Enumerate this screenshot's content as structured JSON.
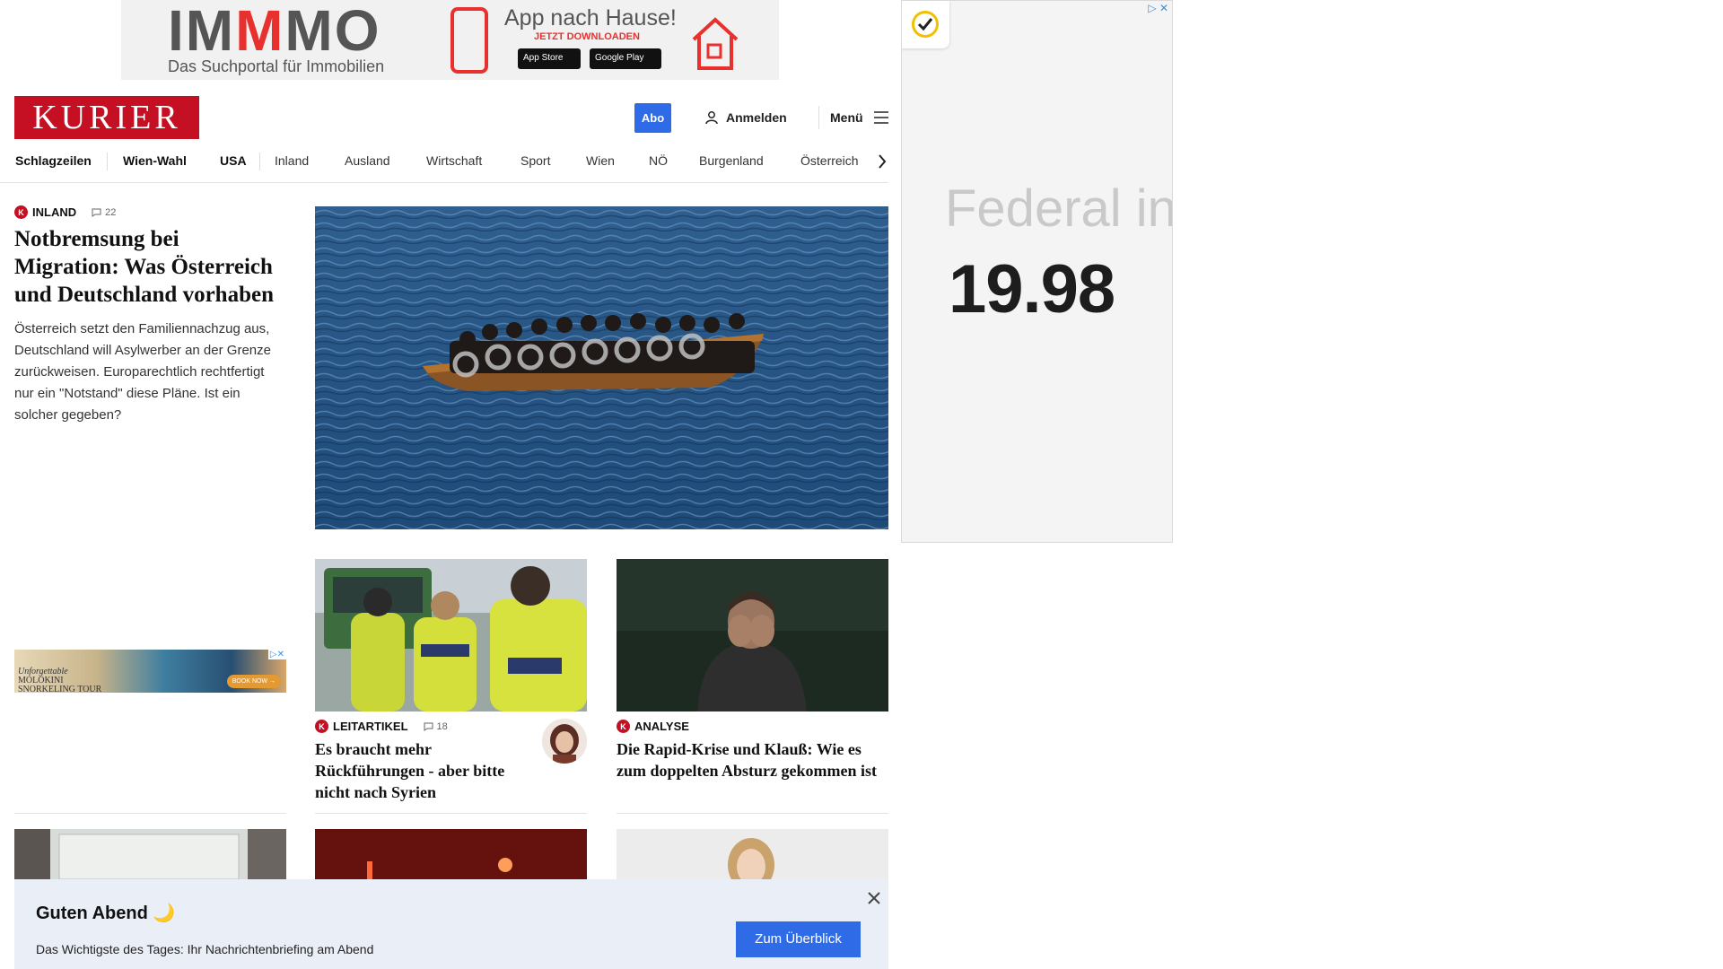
{
  "top_ad": {
    "logo_letters": [
      "IM",
      "M",
      "MO"
    ],
    "subtitle": "Das Suchportal für Immobilien",
    "headline": "App nach Hause!",
    "cta": "JETZT DOWNLOADEN",
    "store_apple": "App Store",
    "store_google": "Google Play",
    "accent_color": "#e8312f"
  },
  "header": {
    "brand": "KURIER",
    "brand_color": "#c50f22",
    "abo_label": "Abo",
    "login_label": "Anmelden",
    "menu_label": "Menü"
  },
  "nav": {
    "items": [
      "Schlagzeilen",
      "Wien-Wahl",
      "USA",
      "Inland",
      "Ausland",
      "Wirtschaft",
      "Sport",
      "Wien",
      "NÖ",
      "Burgenland",
      "Österreich"
    ]
  },
  "lead": {
    "category": "INLAND",
    "comments": "22",
    "headline": "Notbremsung bei Migration: Was Österreich und Deutschland vorhaben",
    "teaser": "Österreich setzt den Familiennachzug aus, Deutschland will Asylwerber an der Grenze zurückweisen. Europarechtlich rechtfertigt nur ein \"Notstand\" diese Pläne. Ist ein solcher gegeben?"
  },
  "cards": [
    {
      "category": "LEITARTIKEL",
      "comments": "18",
      "headline": "Es braucht mehr Rückführungen - aber bitte nicht nach Syrien"
    },
    {
      "category": "ANALYSE",
      "headline": "Die Rapid-Krise und Klauß: Wie es zum doppelten Absturz gekommen ist"
    }
  ],
  "small_ad": {
    "text_line1": "Unforgettable",
    "text_line2": "MOLOKINI",
    "text_line3": "SNORKELING TOUR",
    "cta": "BOOK NOW →"
  },
  "right_ad": {
    "partial_text": "Federal in",
    "value": "19.98"
  },
  "briefing": {
    "title": "Guten Abend",
    "emoji": "🌙",
    "description": "Das Wichtigste des Tages: Ihr Nachrichtenbriefing am Abend",
    "cta": "Zum Überblick"
  },
  "icons": {
    "user": "user-icon",
    "menu": "hamburger-icon",
    "comment": "comment-icon",
    "chevron": "chevron-right-icon",
    "close": "close-icon",
    "brand_k": "K"
  }
}
